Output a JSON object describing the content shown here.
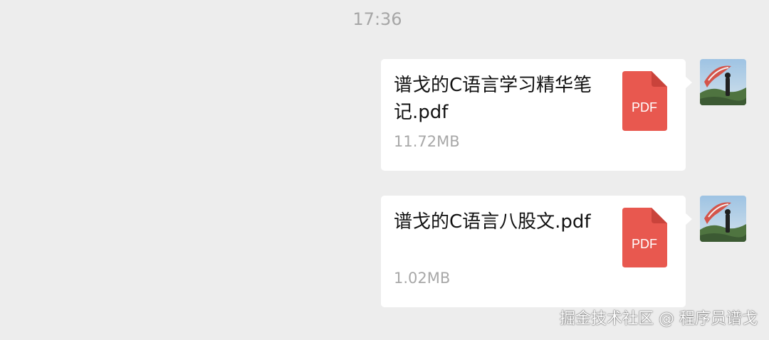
{
  "chat": {
    "timestamp": "17:36",
    "messages": [
      {
        "type": "file",
        "file_name": "谱戈的C语言学习精华笔记.pdf",
        "file_size": "11.72MB",
        "file_icon": "pdf-icon",
        "file_icon_label": "PDF"
      },
      {
        "type": "file",
        "file_name": "谱戈的C语言八股文.pdf",
        "file_size": "1.02MB",
        "file_icon": "pdf-icon",
        "file_icon_label": "PDF"
      }
    ]
  },
  "colors": {
    "background": "#ededed",
    "bubble": "#ffffff",
    "pdf_red": "#e8584f",
    "muted_text": "#a8a8a8"
  },
  "watermark": "掘金技术社区 @ 程序员谱戈"
}
